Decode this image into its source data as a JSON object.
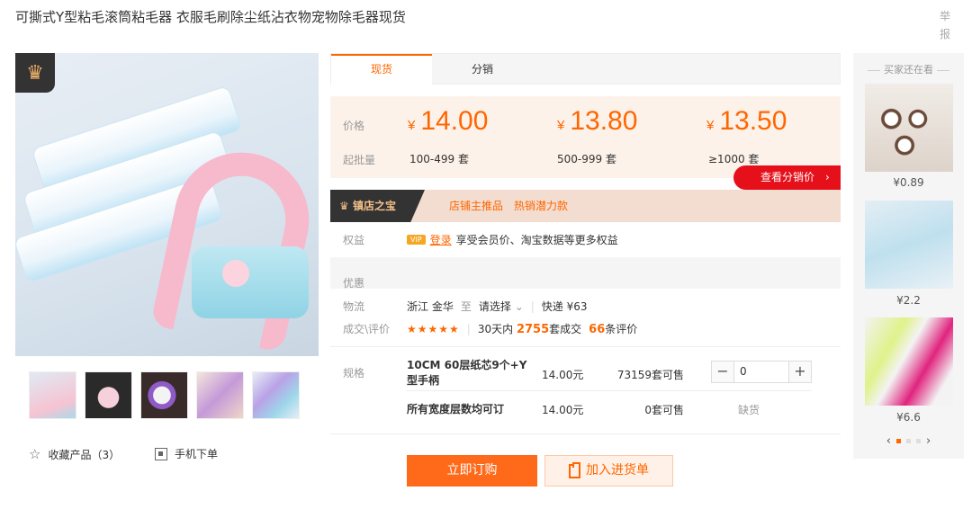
{
  "title": "可撕式Y型粘毛滚筒粘毛器 衣服毛刷除尘纸沾衣物宠物除毛器现货",
  "report_label": "举报",
  "tabs": [
    {
      "label": "现货"
    },
    {
      "label": "分销"
    }
  ],
  "price_label": "价格",
  "moq_label": "起批量",
  "currency": "¥",
  "prices": [
    {
      "value": "14.00",
      "range": "100-499 套"
    },
    {
      "value": "13.80",
      "range": "500-999 套"
    },
    {
      "value": "13.50",
      "range": "≥1000 套"
    }
  ],
  "distribution_button": "查看分销价　›",
  "treasure": {
    "tag": "镇店之宝",
    "text": "店铺主推品　热销潜力款"
  },
  "rights": {
    "label": "权益",
    "vip": "VIP",
    "login": "登录",
    "text": "享受会员价、淘宝数据等更多权益"
  },
  "promo_label": "优惠",
  "logistics": {
    "label": "物流",
    "from": "浙江 金华",
    "to_word": "至",
    "select": "请选择",
    "chevron": "⌄",
    "shipping": "快递 ¥63"
  },
  "reviews": {
    "label": "成交\\评价",
    "stars": "★★★★★",
    "prefix": "30天内",
    "deals": "2755",
    "deals_suffix": "套成交",
    "count": "66",
    "count_suffix": "条评价"
  },
  "spec_label": "规格",
  "specs": [
    {
      "name": "10CM 60层纸芯9个+Y型手柄",
      "price": "14.00元",
      "stock": "73159套可售",
      "qty": "0"
    },
    {
      "name": "所有宽度层数均可订",
      "price": "14.00元",
      "stock": "0套可售",
      "status": "缺货"
    }
  ],
  "stepper": {
    "minus": "−",
    "plus": "+"
  },
  "buttons": {
    "order": "立即订购",
    "cart": "加入进货单"
  },
  "actions": {
    "favorite": "收藏产品（3）",
    "mobile": "手机下单"
  },
  "rail": {
    "title": "买家还在看",
    "items": [
      {
        "price": "¥0.89"
      },
      {
        "price": "¥2.2"
      },
      {
        "price": "¥6.6"
      }
    ],
    "prev": "‹",
    "next": "›"
  },
  "colors": {
    "accent": "#ff6600",
    "price_bg": "#fdf2ea",
    "red_button": "#e5101a"
  }
}
